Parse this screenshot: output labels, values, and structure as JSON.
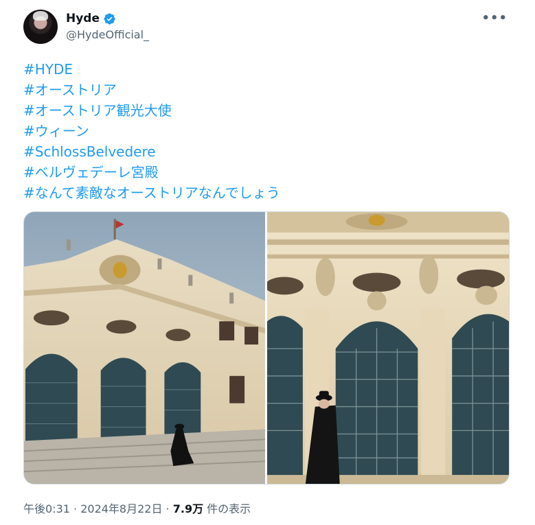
{
  "author": {
    "display_name": "Hyde",
    "handle": "@HydeOfficial_"
  },
  "hashtags": [
    "#HYDE",
    "#オーストリア",
    "#オーストリア観光大使",
    "#ウィーン",
    "#SchlossBelvedere",
    "#ベルヴェデーレ宮殿",
    "#なんて素敵なオーストリアなんでしょう"
  ],
  "meta": {
    "time": "午後0:31",
    "separator1": " · ",
    "date": "2024年8月22日",
    "separator2": " · ",
    "views_count": "7.9万",
    "views_label": " 件の表示"
  },
  "icons": {
    "verified": "verified-badge-icon",
    "more": "more-options-icon"
  },
  "colors": {
    "accent": "#1d9bf0",
    "secondary_text": "#536471",
    "primary_text": "#0f1419"
  }
}
